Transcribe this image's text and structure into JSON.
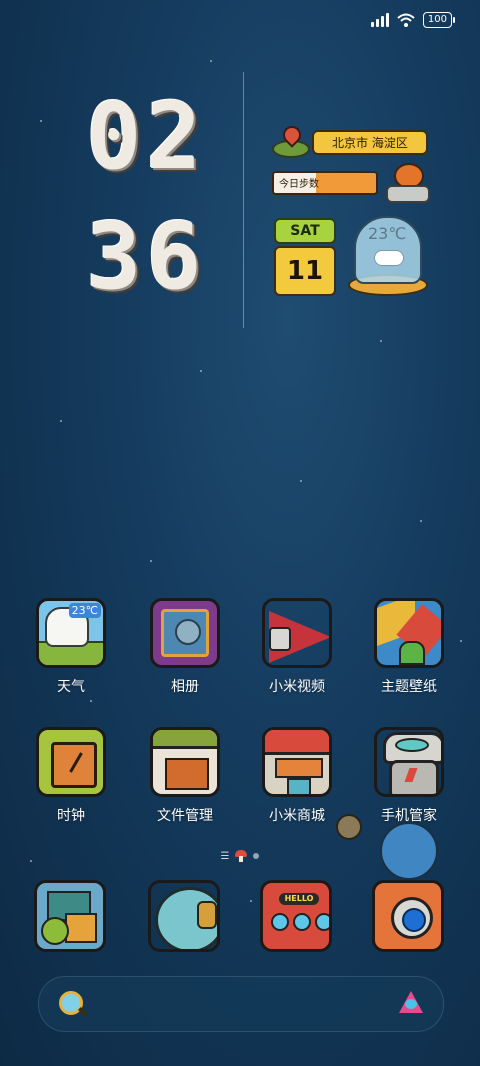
{
  "status_bar": {
    "battery": "100",
    "icons": [
      "signal-icon",
      "wifi-icon",
      "battery-icon"
    ]
  },
  "clock": {
    "h1": "0",
    "h2": "2",
    "m1": "3",
    "m2": "6"
  },
  "widgets": {
    "location": "北京市 海淀区",
    "steps_label": "今日步数",
    "day": "SAT",
    "date": "11",
    "temperature": "23℃"
  },
  "apps": [
    {
      "name": "weather",
      "label": "天气",
      "temp": "23℃",
      "icon": "weather-icon"
    },
    {
      "name": "gallery",
      "label": "相册",
      "icon": "gallery-icon"
    },
    {
      "name": "mi-video",
      "label": "小米视频",
      "icon": "video-icon"
    },
    {
      "name": "themes",
      "label": "主题壁纸",
      "icon": "themes-icon"
    },
    {
      "name": "clock",
      "label": "时钟",
      "icon": "clock-icon"
    },
    {
      "name": "file-manager",
      "label": "文件管理",
      "icon": "folder-icon"
    },
    {
      "name": "mi-store",
      "label": "小米商城",
      "icon": "store-icon"
    },
    {
      "name": "security",
      "label": "手机管家",
      "icon": "robot-icon"
    }
  ],
  "dock": [
    {
      "name": "phone",
      "icon": "phone-icon"
    },
    {
      "name": "browser",
      "icon": "browser-icon"
    },
    {
      "name": "messages",
      "icon": "messages-icon",
      "plate": "HELLO"
    },
    {
      "name": "camera",
      "icon": "camera-icon"
    }
  ],
  "search": {
    "icons": [
      "search-icon",
      "xiaoai-icon"
    ]
  }
}
